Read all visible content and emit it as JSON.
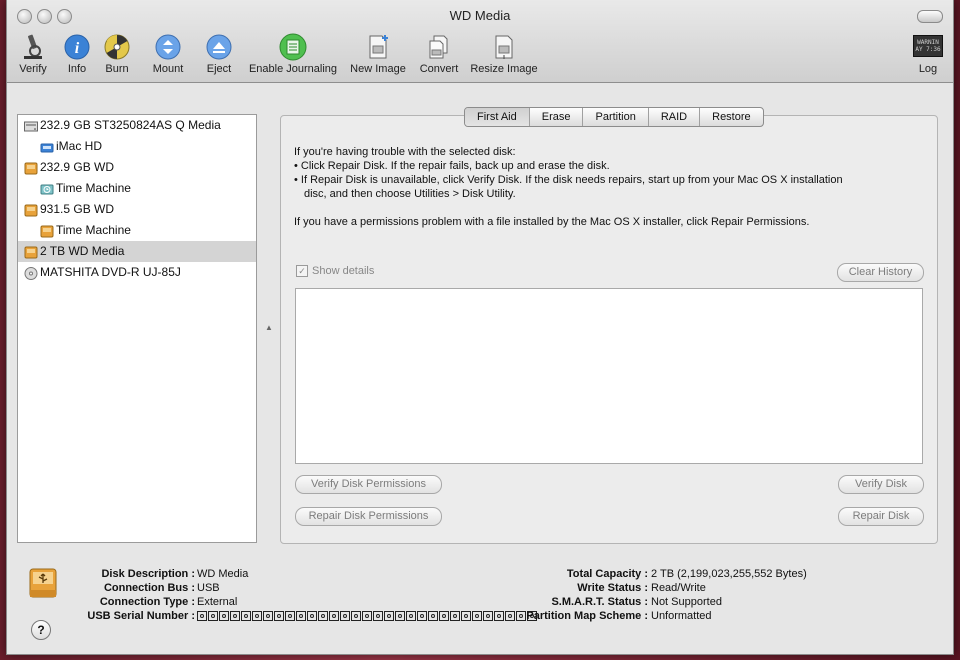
{
  "window": {
    "title": "WD Media"
  },
  "toolbar": {
    "items": [
      {
        "label": "Verify",
        "icon": "microscope-icon"
      },
      {
        "label": "Info",
        "icon": "info-icon"
      },
      {
        "label": "Burn",
        "icon": "burn-icon"
      },
      {
        "label": "Mount",
        "icon": "mount-icon"
      },
      {
        "label": "Eject",
        "icon": "eject-icon"
      },
      {
        "label": "Enable Journaling",
        "icon": "journaling-icon"
      },
      {
        "label": "New Image",
        "icon": "new-image-icon"
      },
      {
        "label": "Convert",
        "icon": "convert-icon"
      },
      {
        "label": "Resize Image",
        "icon": "resize-image-icon"
      },
      {
        "label": "Log",
        "icon": "log-icon"
      }
    ],
    "log_icon_text": "WARNIN\nAY 7:36"
  },
  "sidebar": {
    "items": [
      {
        "label": "232.9 GB ST3250824AS Q Media",
        "icon": "internal-drive-icon",
        "level": 0
      },
      {
        "label": "iMac HD",
        "icon": "volume-icon",
        "level": 1
      },
      {
        "label": "232.9 GB WD",
        "icon": "external-drive-icon",
        "level": 0
      },
      {
        "label": "Time Machine",
        "icon": "time-machine-volume-icon",
        "level": 1
      },
      {
        "label": "931.5 GB WD",
        "icon": "external-drive-icon",
        "level": 0
      },
      {
        "label": "Time Machine",
        "icon": "external-drive-icon",
        "level": 1
      },
      {
        "label": "2 TB WD Media",
        "icon": "external-drive-icon",
        "level": 0,
        "selected": true
      },
      {
        "label": "MATSHITA DVD-R UJ-85J",
        "icon": "optical-drive-icon",
        "level": 0
      }
    ]
  },
  "tabs": [
    "First Aid",
    "Erase",
    "Partition",
    "RAID",
    "Restore"
  ],
  "first_aid": {
    "intro": "If you're having trouble with the selected disk:",
    "bullet1": "• Click Repair Disk. If the repair fails, back up and erase the disk.",
    "bullet2a": "• If Repair Disk is unavailable, click Verify Disk. If the disk needs repairs, start up from your Mac OS X installation",
    "bullet2b": "  disc, and then choose Utilities > Disk Utility.",
    "permissions": "If you have a permissions problem with a file installed by the Mac OS X installer, click Repair Permissions.",
    "show_details": "Show details",
    "show_details_checked": true,
    "clear_history": "Clear History",
    "verify_permissions": "Verify Disk Permissions",
    "repair_permissions": "Repair Disk Permissions",
    "verify_disk": "Verify Disk",
    "repair_disk": "Repair Disk"
  },
  "info": {
    "left": [
      {
        "key": "Disk Description :",
        "value": "WD Media"
      },
      {
        "key": "Connection Bus :",
        "value": "USB"
      },
      {
        "key": "Connection Type :",
        "value": "External"
      },
      {
        "key": "USB Serial Number :",
        "value": ""
      }
    ],
    "right": [
      {
        "key": "Total Capacity :",
        "value": "2 TB (2,199,023,255,552 Bytes)"
      },
      {
        "key": "Write Status :",
        "value": "Read/Write"
      },
      {
        "key": "S.M.A.R.T. Status :",
        "value": "Not Supported"
      },
      {
        "key": "Partition Map Scheme :",
        "value": "Unformatted"
      }
    ],
    "help": "?"
  },
  "colors": {
    "drive_orange": "#e8a23a",
    "info_blue": "#3b82d6",
    "journaling_green": "#4fbf4f"
  }
}
